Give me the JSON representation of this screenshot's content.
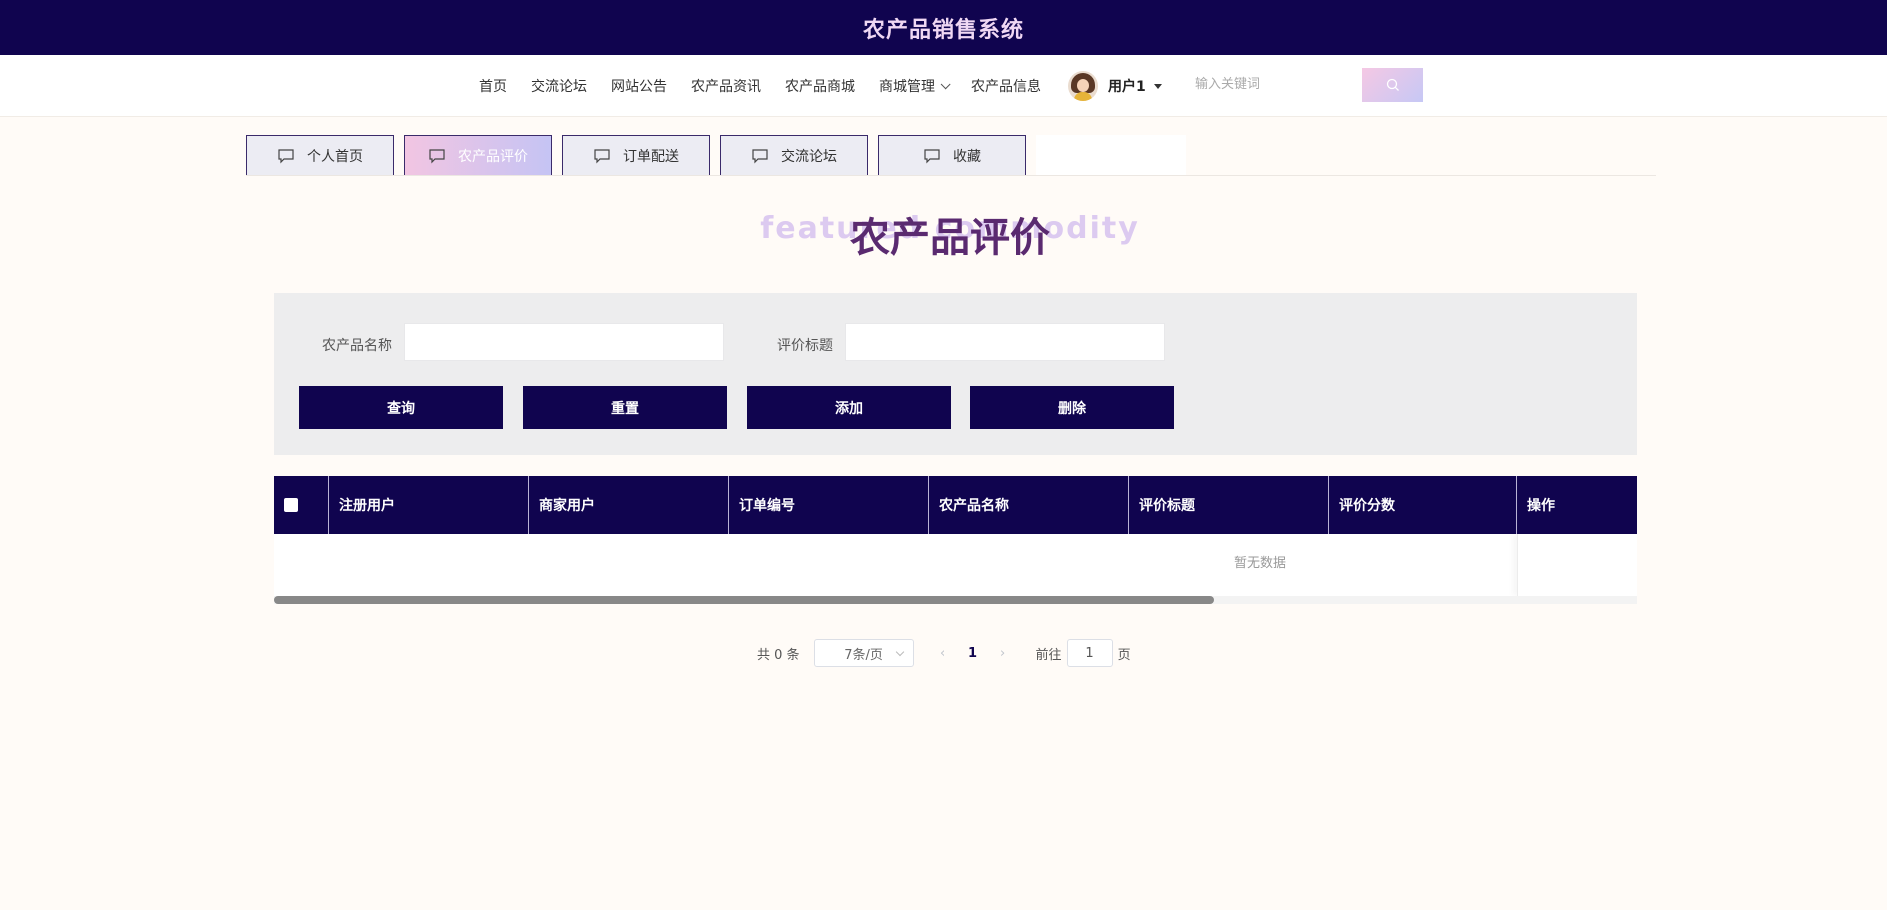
{
  "header": {
    "title": "农产品销售系统"
  },
  "nav": {
    "items": [
      "首页",
      "交流论坛",
      "网站公告",
      "农产品资讯",
      "农产品商城"
    ],
    "dropdown": "商城管理",
    "last": "农产品信息",
    "user": "用户1",
    "search_placeholder": "输入关键词"
  },
  "tabs": [
    {
      "label": "个人首页",
      "active": false
    },
    {
      "label": "农产品评价",
      "active": true
    },
    {
      "label": "订单配送",
      "active": false
    },
    {
      "label": "交流论坛",
      "active": false
    },
    {
      "label": "收藏",
      "active": false
    }
  ],
  "page": {
    "title": "农产品评价",
    "bg_text": "featured commodity"
  },
  "filters": {
    "product_name_label": "农产品名称",
    "product_name_value": "",
    "review_title_label": "评价标题",
    "review_title_value": ""
  },
  "buttons": {
    "query": "查询",
    "reset": "重置",
    "add": "添加",
    "delete": "删除"
  },
  "table": {
    "columns": [
      "注册用户",
      "商家用户",
      "订单编号",
      "农产品名称",
      "评价标题",
      "评价分数",
      "操作"
    ],
    "empty_text": "暂无数据"
  },
  "pagination": {
    "total_text": "共 0 条",
    "page_size": "7条/页",
    "current_page": "1",
    "goto_label": "前往",
    "goto_value": "1",
    "page_suffix": "页"
  },
  "colors": {
    "primary": "#10044f",
    "accent_title": "#5a2a70",
    "background": "#fffbf7"
  }
}
